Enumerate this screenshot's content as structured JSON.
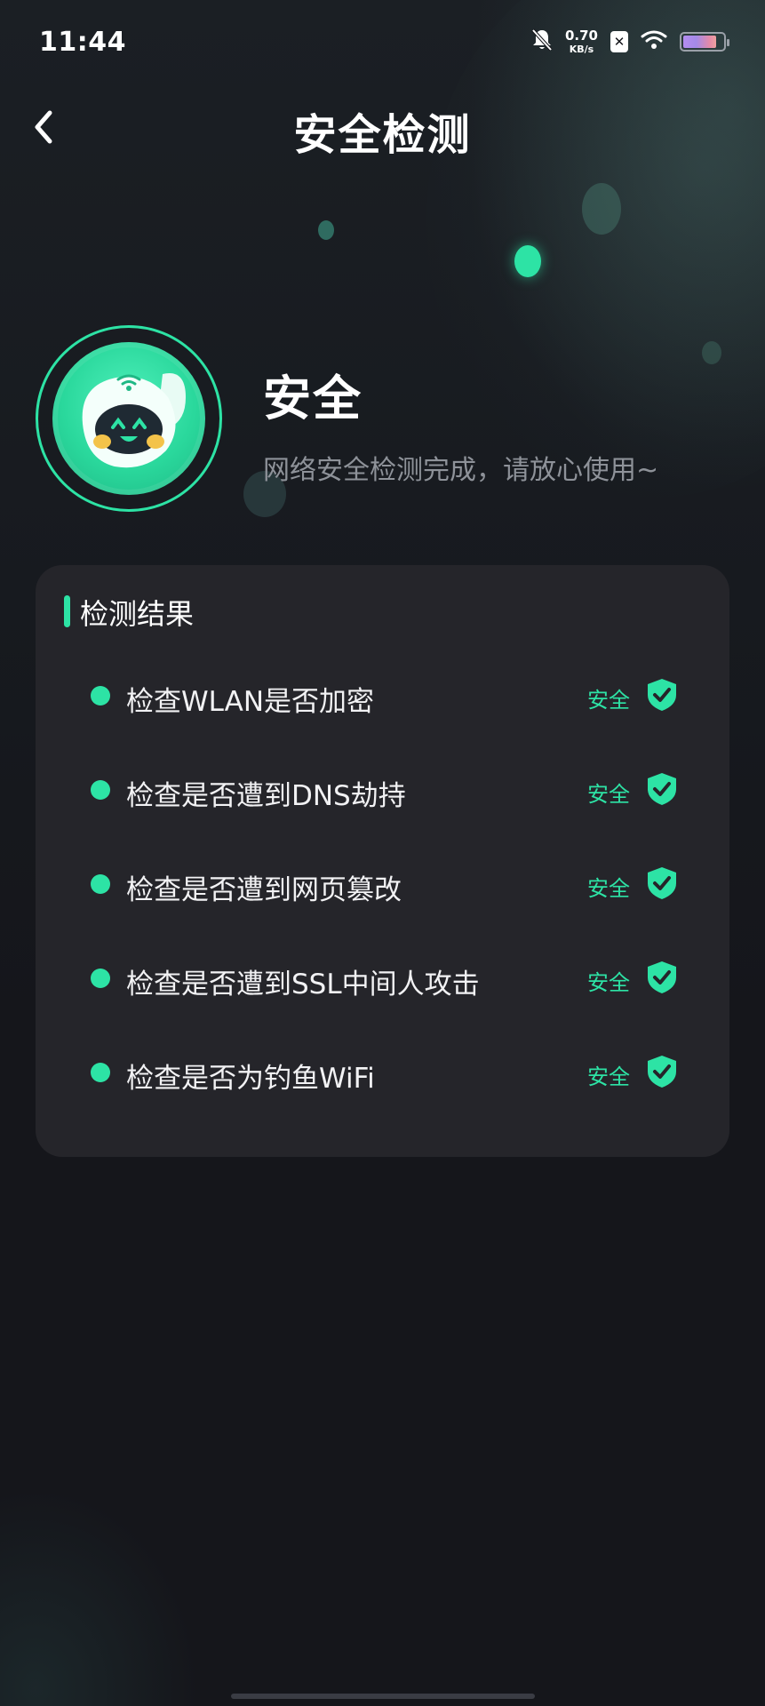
{
  "status_bar": {
    "time": "11:44",
    "net_speed_value": "0.70",
    "net_speed_unit": "KB/s",
    "battery_level": 0.85,
    "icons": [
      "bell-off-icon",
      "sim-off-icon",
      "wifi-icon",
      "battery-icon"
    ]
  },
  "header": {
    "back_icon": "chevron-left-icon",
    "title": "安全检测"
  },
  "hero": {
    "mascot_icon": "robot-mascot-icon",
    "status": "安全",
    "description": "网络安全检测完成，请放心使用~"
  },
  "results": {
    "title": "检测结果",
    "items": [
      {
        "label": "检查WLAN是否加密",
        "status": "安全"
      },
      {
        "label": "检查是否遭到DNS劫持",
        "status": "安全"
      },
      {
        "label": "检查是否遭到网页篡改",
        "status": "安全"
      },
      {
        "label": "检查是否遭到SSL中间人攻击",
        "status": "安全"
      },
      {
        "label": "检查是否为钓鱼WiFi",
        "status": "安全"
      }
    ]
  },
  "colors": {
    "accent": "#2de3a5",
    "background": "#15161b",
    "card": "#25252a",
    "muted_text": "#8e9299"
  }
}
